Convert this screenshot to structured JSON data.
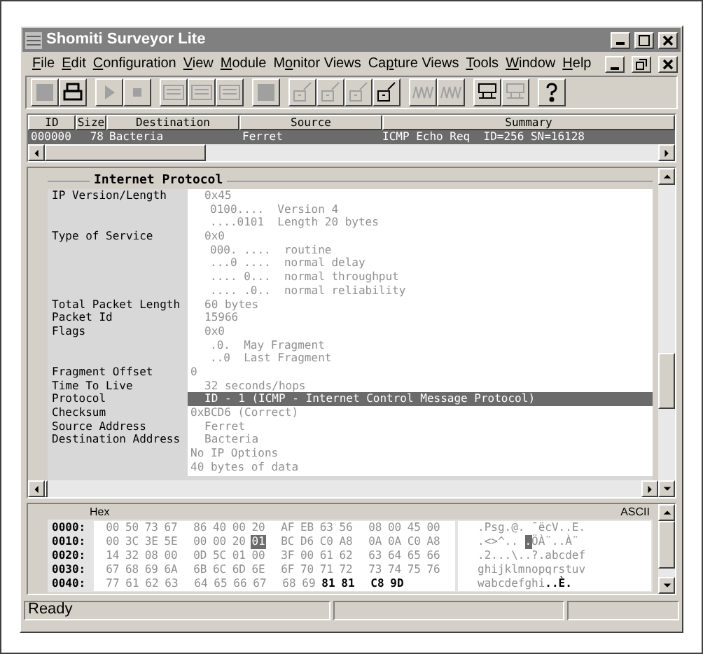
{
  "window": {
    "title": "Shomiti Surveyor Lite"
  },
  "menu": [
    {
      "key": "F",
      "post": "ile"
    },
    {
      "key": "E",
      "post": "dit"
    },
    {
      "key": "C",
      "post": "onfiguration"
    },
    {
      "key": "V",
      "post": "iew"
    },
    {
      "key": "M",
      "post": "odule"
    },
    {
      "pre": "M",
      "key": "o",
      "post": "nitor Views"
    },
    {
      "pre": "Ca",
      "key": "p",
      "post": "ture Views"
    },
    {
      "key": "T",
      "post": "ools"
    },
    {
      "key": "W",
      "post": "indow"
    },
    {
      "key": "H",
      "post": "elp"
    }
  ],
  "toolbar": [
    [
      {
        "disabled": true
      },
      {
        "disabled": false
      }
    ],
    [
      {
        "disabled": true
      },
      {
        "disabled": true
      }
    ],
    [
      {
        "disabled": true
      },
      {
        "disabled": true
      },
      {
        "disabled": true
      }
    ],
    [
      {
        "disabled": true
      }
    ],
    [
      {
        "disabled": true
      },
      {
        "disabled": true
      },
      {
        "disabled": true
      },
      {
        "disabled": false
      }
    ],
    [
      {
        "disabled": true
      },
      {
        "disabled": true
      }
    ],
    [
      {
        "disabled": false
      },
      {
        "disabled": true
      }
    ],
    [
      {
        "disabled": false
      }
    ]
  ],
  "packet_list": {
    "columns": [
      "ID",
      "Size",
      "Destination",
      "Source",
      "Summary"
    ],
    "rows": [
      {
        "id": "000000",
        "size": "78",
        "destination": "Bacteria",
        "source": "Ferret",
        "summary": "ICMP Echo Req  ID=256 SN=16128",
        "selected": true
      }
    ]
  },
  "detail": {
    "title": "Internet Protocol",
    "fields": [
      {
        "label": "IP Version/Length",
        "lines": [
          {
            "text": "0x45",
            "kind": "value",
            "selected": false
          },
          {
            "text": "0100....  Version 4",
            "kind": "bit",
            "selected": false
          },
          {
            "text": "....0101  Length 20 bytes",
            "kind": "bit",
            "selected": false
          }
        ]
      },
      {
        "label": "Type of Service",
        "lines": [
          {
            "text": "0x0",
            "kind": "value",
            "selected": false
          },
          {
            "text": "000. ....  routine",
            "kind": "bit",
            "selected": false
          },
          {
            "text": "...0 ....  normal delay",
            "kind": "bit",
            "selected": false
          },
          {
            "text": ".... 0...  normal throughput",
            "kind": "bit",
            "selected": false
          },
          {
            "text": ".... .0..  normal reliability",
            "kind": "bit",
            "selected": false
          }
        ]
      },
      {
        "label": "Total Packet Length",
        "lines": [
          {
            "text": "60 bytes",
            "kind": "value",
            "selected": false
          }
        ]
      },
      {
        "label": "Packet Id",
        "lines": [
          {
            "text": "15966",
            "kind": "value",
            "selected": false
          }
        ]
      },
      {
        "label": "Flags",
        "lines": [
          {
            "text": "0x0",
            "kind": "value",
            "selected": false
          },
          {
            "text": ".0.  May Fragment",
            "kind": "bit",
            "selected": false
          },
          {
            "text": "..0  Last Fragment",
            "kind": "bit",
            "selected": false
          }
        ]
      },
      {
        "label": "Fragment Offset",
        "lines": [
          {
            "text": "0",
            "kind": "flush",
            "selected": false
          }
        ]
      },
      {
        "label": "Time To Live",
        "lines": [
          {
            "text": "32 seconds/hops",
            "kind": "value",
            "selected": false
          }
        ]
      },
      {
        "label": "Protocol",
        "lines": [
          {
            "text": "ID - 1 (ICMP - Internet Control Message Protocol)",
            "kind": "value",
            "selected": true
          }
        ]
      },
      {
        "label": "Checksum",
        "lines": [
          {
            "text": "0xBCD6 (Correct)",
            "kind": "flush",
            "selected": false
          }
        ]
      },
      {
        "label": "Source Address",
        "lines": [
          {
            "text": "Ferret",
            "kind": "value",
            "selected": false
          }
        ]
      },
      {
        "label": "Destination Address",
        "lines": [
          {
            "text": "Bacteria",
            "kind": "value",
            "selected": false
          }
        ]
      },
      {
        "lines": [
          {
            "text": "No IP Options",
            "kind": "flush",
            "selected": false
          }
        ]
      },
      {
        "lines": [
          {
            "text": "40 bytes of data",
            "kind": "flush",
            "selected": false
          }
        ]
      }
    ]
  },
  "hex": {
    "hex_label": "Hex",
    "ascii_label": "ASCII",
    "rows": [
      {
        "offset": "0000:",
        "bytes": [
          {
            "t": "00",
            "kind": "plain"
          },
          {
            "t": "50",
            "kind": "plain"
          },
          {
            "t": "73",
            "kind": "plain"
          },
          {
            "t": "67",
            "kind": "plain"
          },
          {
            "t": "86",
            "kind": "plain"
          },
          {
            "t": "40",
            "kind": "plain"
          },
          {
            "t": "00",
            "kind": "plain"
          },
          {
            "t": "20",
            "kind": "plain"
          },
          {
            "t": "AF",
            "kind": "plain"
          },
          {
            "t": "EB",
            "kind": "plain"
          },
          {
            "t": "63",
            "kind": "plain"
          },
          {
            "t": "56",
            "kind": "plain"
          },
          {
            "t": "08",
            "kind": "plain"
          },
          {
            "t": "00",
            "kind": "plain"
          },
          {
            "t": "45",
            "kind": "plain"
          },
          {
            "t": "00",
            "kind": "plain"
          }
        ],
        "ascii": [
          {
            "t": ".Psg.@. ¯ëcV..E.",
            "kind": "plain"
          }
        ]
      },
      {
        "offset": "0010:",
        "bytes": [
          {
            "t": "00",
            "kind": "plain"
          },
          {
            "t": "3C",
            "kind": "plain"
          },
          {
            "t": "3E",
            "kind": "plain"
          },
          {
            "t": "5E",
            "kind": "plain"
          },
          {
            "t": "00",
            "kind": "plain"
          },
          {
            "t": "00",
            "kind": "plain"
          },
          {
            "t": "20",
            "kind": "plain"
          },
          {
            "t": "01",
            "kind": "selected"
          },
          {
            "t": "BC",
            "kind": "plain"
          },
          {
            "t": "D6",
            "kind": "plain"
          },
          {
            "t": "C0",
            "kind": "plain"
          },
          {
            "t": "A8",
            "kind": "plain"
          },
          {
            "t": "0A",
            "kind": "plain"
          },
          {
            "t": "0A",
            "kind": "plain"
          },
          {
            "t": "C0",
            "kind": "plain"
          },
          {
            "t": "A8",
            "kind": "plain"
          }
        ],
        "ascii": [
          {
            "t": ".<>^.. ",
            "kind": "plain"
          },
          {
            "t": ".",
            "kind": "selected"
          },
          {
            "t": "ÖÀ¨..À¨",
            "kind": "plain"
          }
        ]
      },
      {
        "offset": "0020:",
        "bytes": [
          {
            "t": "14",
            "kind": "plain"
          },
          {
            "t": "32",
            "kind": "plain"
          },
          {
            "t": "08",
            "kind": "plain"
          },
          {
            "t": "00",
            "kind": "plain"
          },
          {
            "t": "0D",
            "kind": "plain"
          },
          {
            "t": "5C",
            "kind": "plain"
          },
          {
            "t": "01",
            "kind": "plain"
          },
          {
            "t": "00",
            "kind": "plain"
          },
          {
            "t": "3F",
            "kind": "plain"
          },
          {
            "t": "00",
            "kind": "plain"
          },
          {
            "t": "61",
            "kind": "plain"
          },
          {
            "t": "62",
            "kind": "plain"
          },
          {
            "t": "63",
            "kind": "plain"
          },
          {
            "t": "64",
            "kind": "plain"
          },
          {
            "t": "65",
            "kind": "plain"
          },
          {
            "t": "66",
            "kind": "plain"
          }
        ],
        "ascii": [
          {
            "t": ".2...\\..?.abcdef",
            "kind": "plain"
          }
        ]
      },
      {
        "offset": "0030:",
        "bytes": [
          {
            "t": "67",
            "kind": "plain"
          },
          {
            "t": "68",
            "kind": "plain"
          },
          {
            "t": "69",
            "kind": "plain"
          },
          {
            "t": "6A",
            "kind": "plain"
          },
          {
            "t": "6B",
            "kind": "plain"
          },
          {
            "t": "6C",
            "kind": "plain"
          },
          {
            "t": "6D",
            "kind": "plain"
          },
          {
            "t": "6E",
            "kind": "plain"
          },
          {
            "t": "6F",
            "kind": "plain"
          },
          {
            "t": "70",
            "kind": "plain"
          },
          {
            "t": "71",
            "kind": "plain"
          },
          {
            "t": "72",
            "kind": "plain"
          },
          {
            "t": "73",
            "kind": "plain"
          },
          {
            "t": "74",
            "kind": "plain"
          },
          {
            "t": "75",
            "kind": "plain"
          },
          {
            "t": "76",
            "kind": "plain"
          }
        ],
        "ascii": [
          {
            "t": "ghijklmnopqrstuv",
            "kind": "plain"
          }
        ]
      },
      {
        "offset": "0040:",
        "bytes": [
          {
            "t": "77",
            "kind": "plain"
          },
          {
            "t": "61",
            "kind": "plain"
          },
          {
            "t": "62",
            "kind": "plain"
          },
          {
            "t": "63",
            "kind": "plain"
          },
          {
            "t": "64",
            "kind": "plain"
          },
          {
            "t": "65",
            "kind": "plain"
          },
          {
            "t": "66",
            "kind": "plain"
          },
          {
            "t": "67",
            "kind": "plain"
          },
          {
            "t": "68",
            "kind": "plain"
          },
          {
            "t": "69",
            "kind": "plain"
          },
          {
            "t": "81",
            "kind": "bold"
          },
          {
            "t": "81",
            "kind": "bold"
          },
          {
            "t": "C8",
            "kind": "bold"
          },
          {
            "t": "9D",
            "kind": "bold"
          }
        ],
        "ascii": [
          {
            "t": "wabcdefghi",
            "kind": "plain"
          },
          {
            "t": "..È.",
            "kind": "bold"
          }
        ]
      }
    ]
  },
  "status_bar": {
    "text": "Ready"
  }
}
